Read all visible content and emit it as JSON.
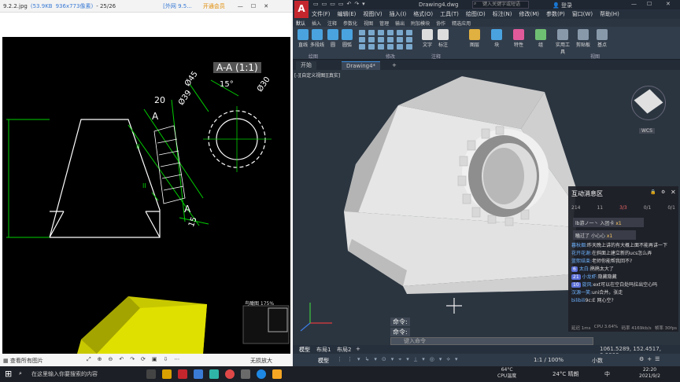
{
  "viewer": {
    "title": "9.2.2.jpg",
    "size_kb": "(53.9KB",
    "dimensions": "936x773像素)",
    "page": "- 25/26",
    "brand": "[外网 9.5...",
    "open_member": "开通会员",
    "section_label": "A-A (1:1)",
    "dims": [
      "20",
      "Ø39",
      "Ø45",
      "15°",
      "Ø30",
      "15",
      "A",
      "A",
      "II",
      "II"
    ],
    "view_all": "查看所有图片",
    "zoom": "鸟瞰图 175%",
    "lossless": "无损放大"
  },
  "cad": {
    "title": "Drawing4.dwg",
    "search_placeholder": "键入关键字或短语",
    "login": "登录",
    "menu": [
      "文件(F)",
      "编辑(E)",
      "视图(V)",
      "插入(I)",
      "格式(O)",
      "工具(T)",
      "绘图(D)",
      "标注(N)",
      "修改(M)",
      "参数(P)",
      "窗口(W)",
      "帮助(H)"
    ],
    "ribbon_tabs": [
      "默认",
      "插入",
      "注释",
      "参数化",
      "视图",
      "管理",
      "输出",
      "附加模块",
      "协作",
      "精选应用"
    ],
    "ribbon_buttons": [
      "直线",
      "多段线",
      "圆",
      "圆弧",
      "文字",
      "标注",
      "图层",
      "块",
      "特性",
      "组",
      "实用工具",
      "剪贴板",
      "基点"
    ],
    "ribbon_groups": [
      "绘图",
      "修改",
      "注释",
      "视图"
    ],
    "doc_tabs": [
      "开始",
      "Drawing4*"
    ],
    "viewport_label": "[-][自定义视图][真实]",
    "viewcube_label": "WCS",
    "cmd_lines": [
      "命令:",
      "命令:"
    ],
    "cmd_placeholder": "键入命令",
    "layout_tabs": [
      "模型",
      "布局1",
      "布局2"
    ],
    "coords": "1061.5289, 152.4517, 0.0000",
    "status_model": "模型",
    "status_scale": "1:1 / 100%",
    "status_unit": "小数"
  },
  "chat": {
    "title": "互动消息区",
    "stats": [
      "214",
      "11",
      "3/3",
      "0/1",
      "0/1"
    ],
    "gift1_user": "lb游ノ一丶",
    "gift1_text": "入团卡",
    "gift1_count": "x1",
    "gift2_user": "瞌过了",
    "gift2_text": "小心心",
    "gift2_count": "x1",
    "messages": [
      {
        "user": "暮秋烟:",
        "text": "昨天晚上讲的有大概上面不能再讲一下"
      },
      {
        "user": "花开花谢:",
        "text": "在斜面上建立新的ucs怎么弄"
      },
      {
        "user": "蓝熙结束:",
        "text": "老师你能帮我回不?"
      },
      {
        "user": "太白:",
        "text": "鹃鹃太大了",
        "level": "6"
      },
      {
        "user": "小龙虾:",
        "text": "隐藏隐藏",
        "level": "21"
      },
      {
        "user": "旋风:",
        "text": "ext可以在空白处吗拉出空心吗",
        "level": "10"
      },
      {
        "user": "汉源一笑:",
        "text": "uni合并。张走"
      },
      {
        "user": "bilibili",
        "text": "9c:E 网心空?"
      }
    ],
    "perf": [
      "延迟 1ms",
      "CPU 3.64%",
      "码率 4169kb/s",
      "帧率 30fps"
    ]
  },
  "taskbar": {
    "search_placeholder": "在这里输入你要搜索的内容",
    "cpu_temp": "64°C",
    "cpu_label": "CPU温度",
    "weather": "24°C 晴朗",
    "ime": "中",
    "time": "22:20",
    "date": "2021/9/2"
  }
}
